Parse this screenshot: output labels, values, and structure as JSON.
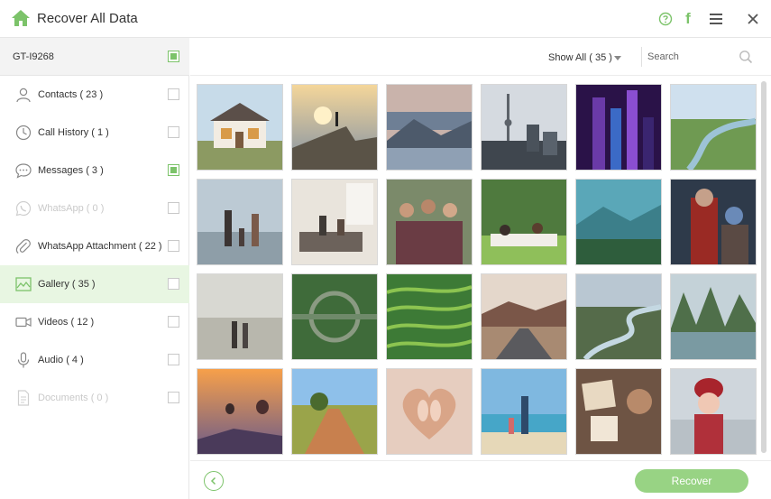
{
  "app": {
    "title": "Recover All Data",
    "accent_color": "#7cc36a",
    "icons": {
      "home": "home-icon",
      "help": "help-icon",
      "facebook": "facebook-icon",
      "menu": "menu-icon",
      "close": "close-icon"
    }
  },
  "sidebar": {
    "device": {
      "name": "GT-I9268",
      "checked": true
    },
    "items": [
      {
        "label": "Contacts ( 23 )",
        "icon": "contacts-icon",
        "checked": false,
        "disabled": false,
        "active": false
      },
      {
        "label": "Call History ( 1 )",
        "icon": "clock-icon",
        "checked": false,
        "disabled": false,
        "active": false
      },
      {
        "label": "Messages ( 3 )",
        "icon": "chat-icon",
        "checked": true,
        "disabled": false,
        "active": false
      },
      {
        "label": "WhatsApp ( 0 )",
        "icon": "whatsapp-icon",
        "checked": false,
        "disabled": true,
        "active": false
      },
      {
        "label": "WhatsApp Attachment ( 22 )",
        "icon": "paperclip-icon",
        "checked": false,
        "disabled": false,
        "active": false
      },
      {
        "label": "Gallery ( 35 )",
        "icon": "gallery-icon",
        "checked": false,
        "disabled": false,
        "active": true
      },
      {
        "label": "Videos ( 12 )",
        "icon": "video-icon",
        "checked": false,
        "disabled": false,
        "active": false
      },
      {
        "label": "Audio ( 4 )",
        "icon": "microphone-icon",
        "checked": false,
        "disabled": false,
        "active": false
      },
      {
        "label": "Documents ( 0 )",
        "icon": "document-icon",
        "checked": false,
        "disabled": true,
        "active": false
      }
    ]
  },
  "toolbar": {
    "filter_label": "Show All ( 35 )",
    "search_placeholder": "Search",
    "search_icon": "search-icon"
  },
  "gallery": {
    "photos": [
      "house-photo",
      "cliff-sunset-photo",
      "mountain-lake-photo",
      "city-tower-photo",
      "night-skyscrapers-photo",
      "river-valley-photo",
      "family-beach-photo",
      "living-room-family-photo",
      "group-selfie-photo",
      "picnic-photo",
      "forest-mountains-photo",
      "superhero-photo",
      "couple-beach-photo",
      "bridge-reflection-photo",
      "rice-terraces-photo",
      "desert-road-photo",
      "winding-river-photo",
      "karst-lake-photo",
      "hot-air-balloons-photo",
      "dirt-road-photo",
      "baby-feet-heart-photo",
      "father-son-beach-photo",
      "photo-collage-photo",
      "child-red-hat-photo"
    ]
  },
  "footer": {
    "back_icon": "chevron-left-icon",
    "recover_label": "Recover"
  }
}
